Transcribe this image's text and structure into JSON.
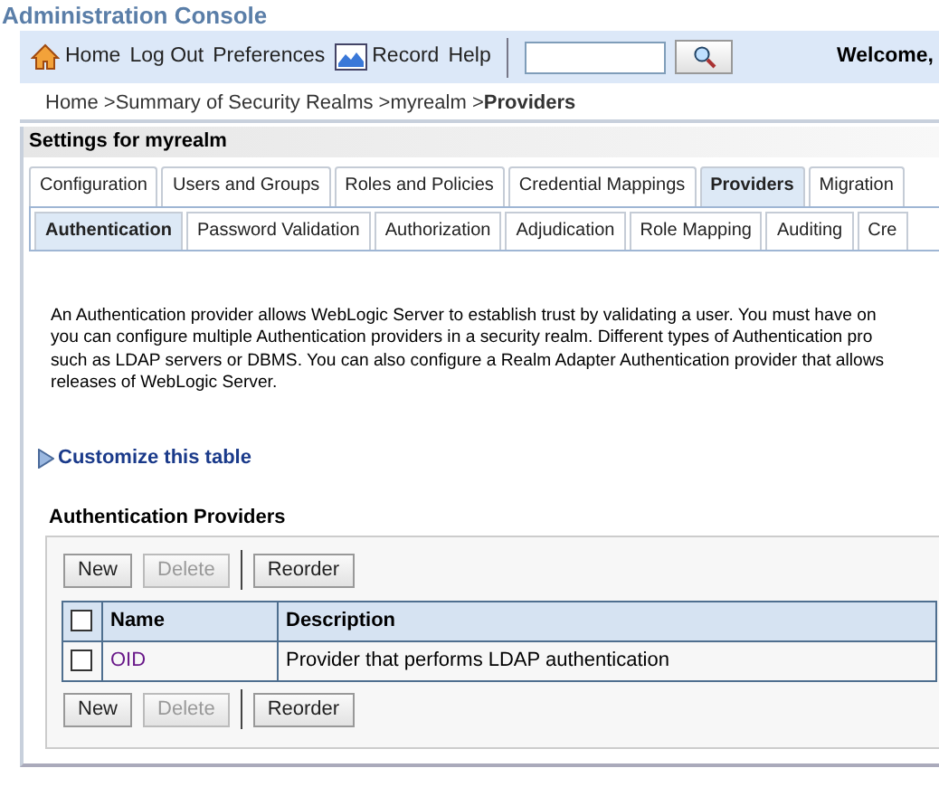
{
  "app_title": "Administration Console",
  "toolbar": {
    "links": [
      {
        "kind": "home",
        "label": "Home"
      },
      {
        "kind": "text",
        "label": "Log Out"
      },
      {
        "kind": "text",
        "label": "Preferences"
      },
      {
        "kind": "record",
        "label": "Record"
      },
      {
        "kind": "text",
        "label": "Help"
      }
    ],
    "welcome": "Welcome,"
  },
  "breadcrumb": [
    {
      "label": "Home >",
      "current": false
    },
    {
      "label": "Summary of Security Realms >",
      "current": false
    },
    {
      "label": "myrealm >",
      "current": false
    },
    {
      "label": "Providers",
      "current": true
    }
  ],
  "panel_title": "Settings for myrealm",
  "tabs": [
    {
      "label": "Configuration",
      "selected": false
    },
    {
      "label": "Users and Groups",
      "selected": false
    },
    {
      "label": "Roles and Policies",
      "selected": false
    },
    {
      "label": "Credential Mappings",
      "selected": false
    },
    {
      "label": "Providers",
      "selected": true
    },
    {
      "label": "Migration",
      "selected": false
    }
  ],
  "subtabs": [
    {
      "label": "Authentication",
      "selected": true
    },
    {
      "label": "Password Validation",
      "selected": false
    },
    {
      "label": "Authorization",
      "selected": false
    },
    {
      "label": "Adjudication",
      "selected": false
    },
    {
      "label": "Role Mapping",
      "selected": false
    },
    {
      "label": "Auditing",
      "selected": false
    },
    {
      "label": "Cre",
      "selected": false
    }
  ],
  "description_lines": [
    "An Authentication provider allows WebLogic Server to establish trust by validating a user. You must have on",
    "you can configure multiple Authentication providers in a security realm. Different types of Authentication pro",
    "such as LDAP servers or DBMS. You can also configure a Realm Adapter Authentication provider that allows",
    "releases of WebLogic Server."
  ],
  "customize_link": "Customize this table",
  "table": {
    "title": "Authentication Providers",
    "buttons": [
      {
        "label": "New",
        "disabled": false
      },
      {
        "label": "Delete",
        "disabled": true
      },
      {
        "label": "Reorder",
        "disabled": false
      }
    ],
    "columns": [
      "Name",
      "Description"
    ],
    "header_checked": false,
    "rows": [
      {
        "name": "OID",
        "description": "Provider that performs LDAP authentication",
        "checked": false
      }
    ],
    "bottom_buttons": [
      {
        "label": "New",
        "disabled": false
      },
      {
        "label": "Delete",
        "disabled": true
      },
      {
        "label": "Reorder",
        "disabled": false
      }
    ]
  }
}
